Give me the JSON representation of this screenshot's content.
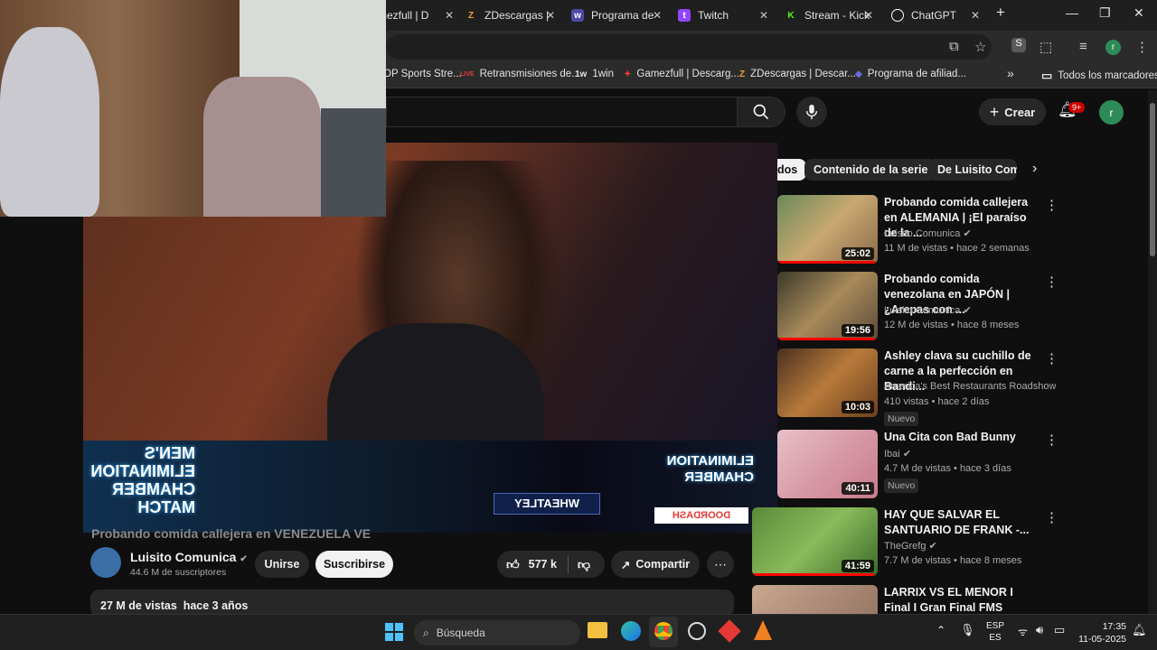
{
  "tabs": [
    {
      "label": "mezfull | D",
      "icon": "gamezfull-tab-icon",
      "color": "#c0392b"
    },
    {
      "label": "ZDescargas |",
      "icon": "zdescargas-tab-icon",
      "color": "#f0a030"
    },
    {
      "label": "Programa de",
      "icon": "program-tab-icon",
      "color": "#4a4aa8"
    },
    {
      "label": "Twitch",
      "icon": "twitch-tab-icon",
      "color": "#9146ff"
    },
    {
      "label": "Stream - Kick",
      "icon": "kick-tab-icon",
      "color": "#53fc18"
    },
    {
      "label": "ChatGPT",
      "icon": "chatgpt-tab-icon",
      "color": "#ffffff"
    }
  ],
  "window_controls": {
    "new_tab": "+",
    "minimize": "—",
    "maximize": "❐",
    "close": "✕"
  },
  "profile_initial": "r",
  "bookmarks": [
    {
      "label": "OP Sports Stre...",
      "icon": ""
    },
    {
      "label": "Retransmisiones de...",
      "icon": "LIVE"
    },
    {
      "label": "1win",
      "icon": "1w"
    },
    {
      "label": "Gamezfull | Descarg...",
      "icon": "✦"
    },
    {
      "label": "ZDescargas | Descar...",
      "icon": "Z"
    },
    {
      "label": "Programa de afiliad...",
      "icon": "◆"
    },
    {
      "label": "»",
      "icon": ""
    },
    {
      "label": "Todos los marcadores",
      "icon": "▭"
    }
  ],
  "youtube": {
    "crear_label": "Crear",
    "notif_badge": "9+",
    "chips": [
      "dos",
      "Contenido de la serie",
      "De Luisito Comu"
    ],
    "video_title_partial": "Probando comida callejera en VENEZUELA  VE",
    "channel": {
      "name": "Luisito Comunica",
      "subs": "44.6 M de suscriptores",
      "join_label": "Unirse",
      "subscribe_label": "Suscribirse"
    },
    "likes": "577 k",
    "share_label": "Compartir",
    "views_date": "27 M de vistas  hace 3 años",
    "overlay_text": {
      "left": "MEN'S ELIMINATION CHAMBER MATCH",
      "right": "ELIMINATION CHAMBER",
      "sponsor1": "WHEATLEY",
      "sponsor2": "DOORDASH"
    },
    "recommendations": [
      {
        "title": "Probando comida callejera en ALEMANIA | ¡El paraíso de la ...",
        "channel": "Luisito Comunica",
        "meta": "11 M de vistas • hace 2 semanas",
        "duration": "25:02",
        "progress": 0.97,
        "nuevo": ""
      },
      {
        "title": "Probando comida venezolana en JAPÓN | ¿Arepas con ...",
        "channel": "Luisito Comunica",
        "meta": "12 M de vistas • hace 8 meses",
        "duration": "19:56",
        "progress": 0.97,
        "nuevo": ""
      },
      {
        "title": "Ashley clava su cuchillo de carne a la perfección en Bandi...",
        "channel": "America's Best Restaurants Roadshow",
        "meta": "410 vistas • hace 2 días",
        "duration": "10:03",
        "progress": 0,
        "nuevo": "Nuevo"
      },
      {
        "title": "Una Cita con Bad Bunny",
        "channel": "Ibai",
        "meta": "4.7 M de vistas • hace 3 días",
        "duration": "40:11",
        "progress": 0,
        "nuevo": "Nuevo"
      },
      {
        "title": "HAY QUE SALVAR EL SANTUARIO DE FRANK -...",
        "channel": "TheGrefg",
        "meta": "7.7 M de vistas • hace 8 meses",
        "duration": "41:59",
        "progress": 0.97,
        "nuevo": ""
      },
      {
        "title": "LARRIX VS EL MENOR I Final I Gran Final FMS Internacional ...",
        "channel": "",
        "meta": "",
        "duration": "",
        "progress": 0,
        "nuevo": ""
      }
    ]
  },
  "taskbar": {
    "search_placeholder": "Búsqueda",
    "lang": "ESP",
    "region": "ES",
    "time": "17:35",
    "date": "11-05-2025"
  }
}
